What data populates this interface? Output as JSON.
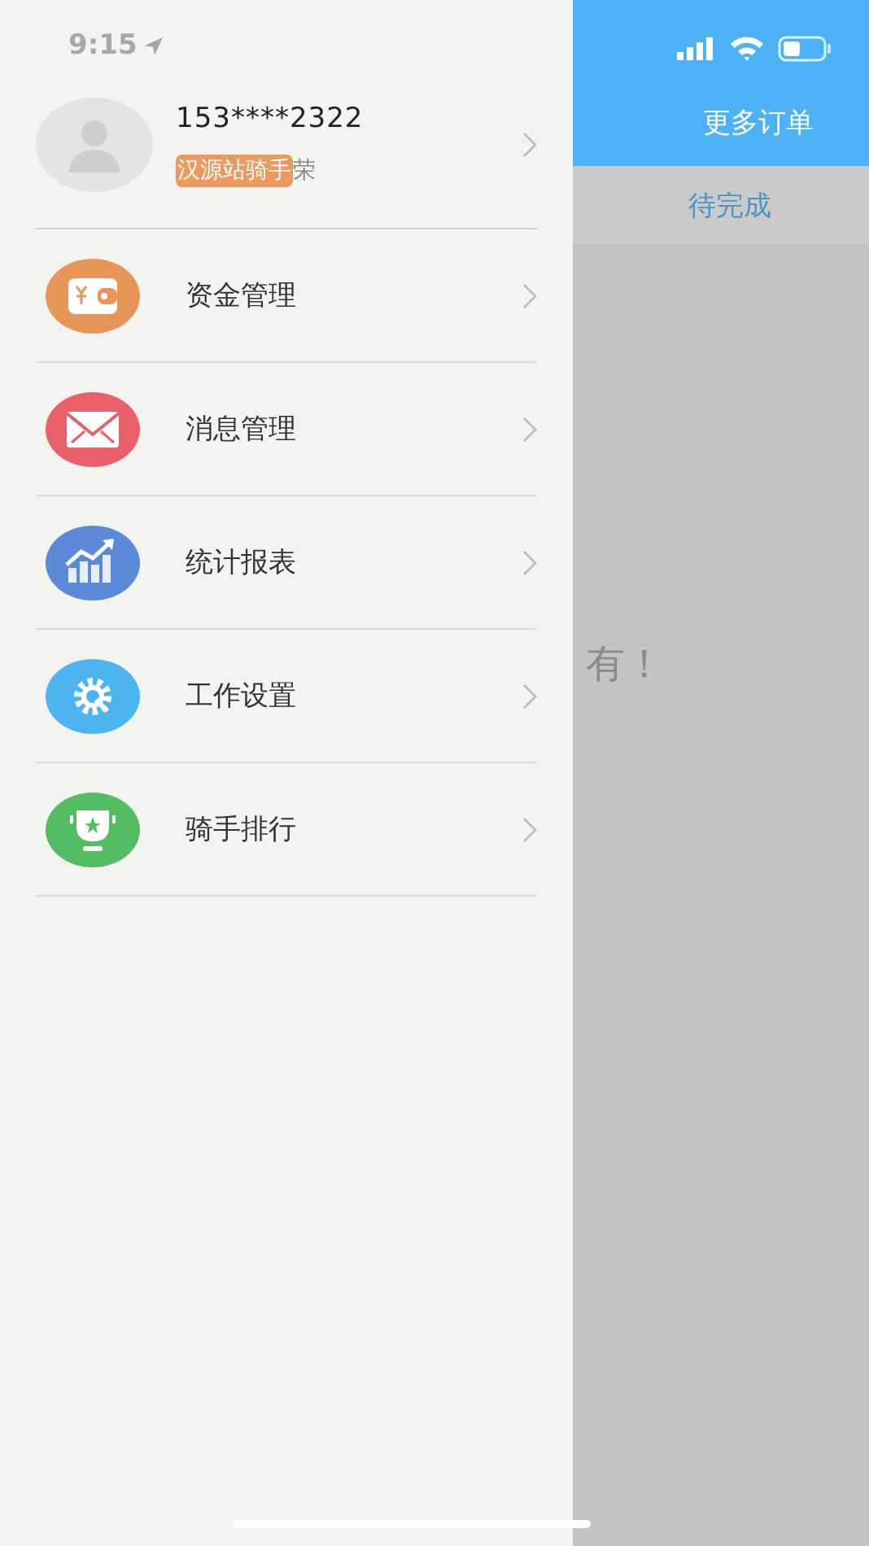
{
  "status_bar": {
    "time": "9:15"
  },
  "profile": {
    "phone": "153****2322",
    "badge": "汉源站骑手",
    "name_fragment": "荣"
  },
  "menu": [
    {
      "label": "资金管理",
      "kind": "wallet",
      "color": "#e8955a"
    },
    {
      "label": "消息管理",
      "kind": "mail",
      "color": "#e9606a"
    },
    {
      "label": "统计报表",
      "kind": "chart",
      "color": "#5b8bd8"
    },
    {
      "label": "工作设置",
      "kind": "settings",
      "color": "#4cb4f0"
    },
    {
      "label": "骑手排行",
      "kind": "trophy",
      "color": "#54bd61"
    }
  ],
  "background": {
    "header_button": "更多订单",
    "tabs": [
      {
        "label": "待完成",
        "selected": true
      }
    ],
    "empty_hint": "有！"
  }
}
